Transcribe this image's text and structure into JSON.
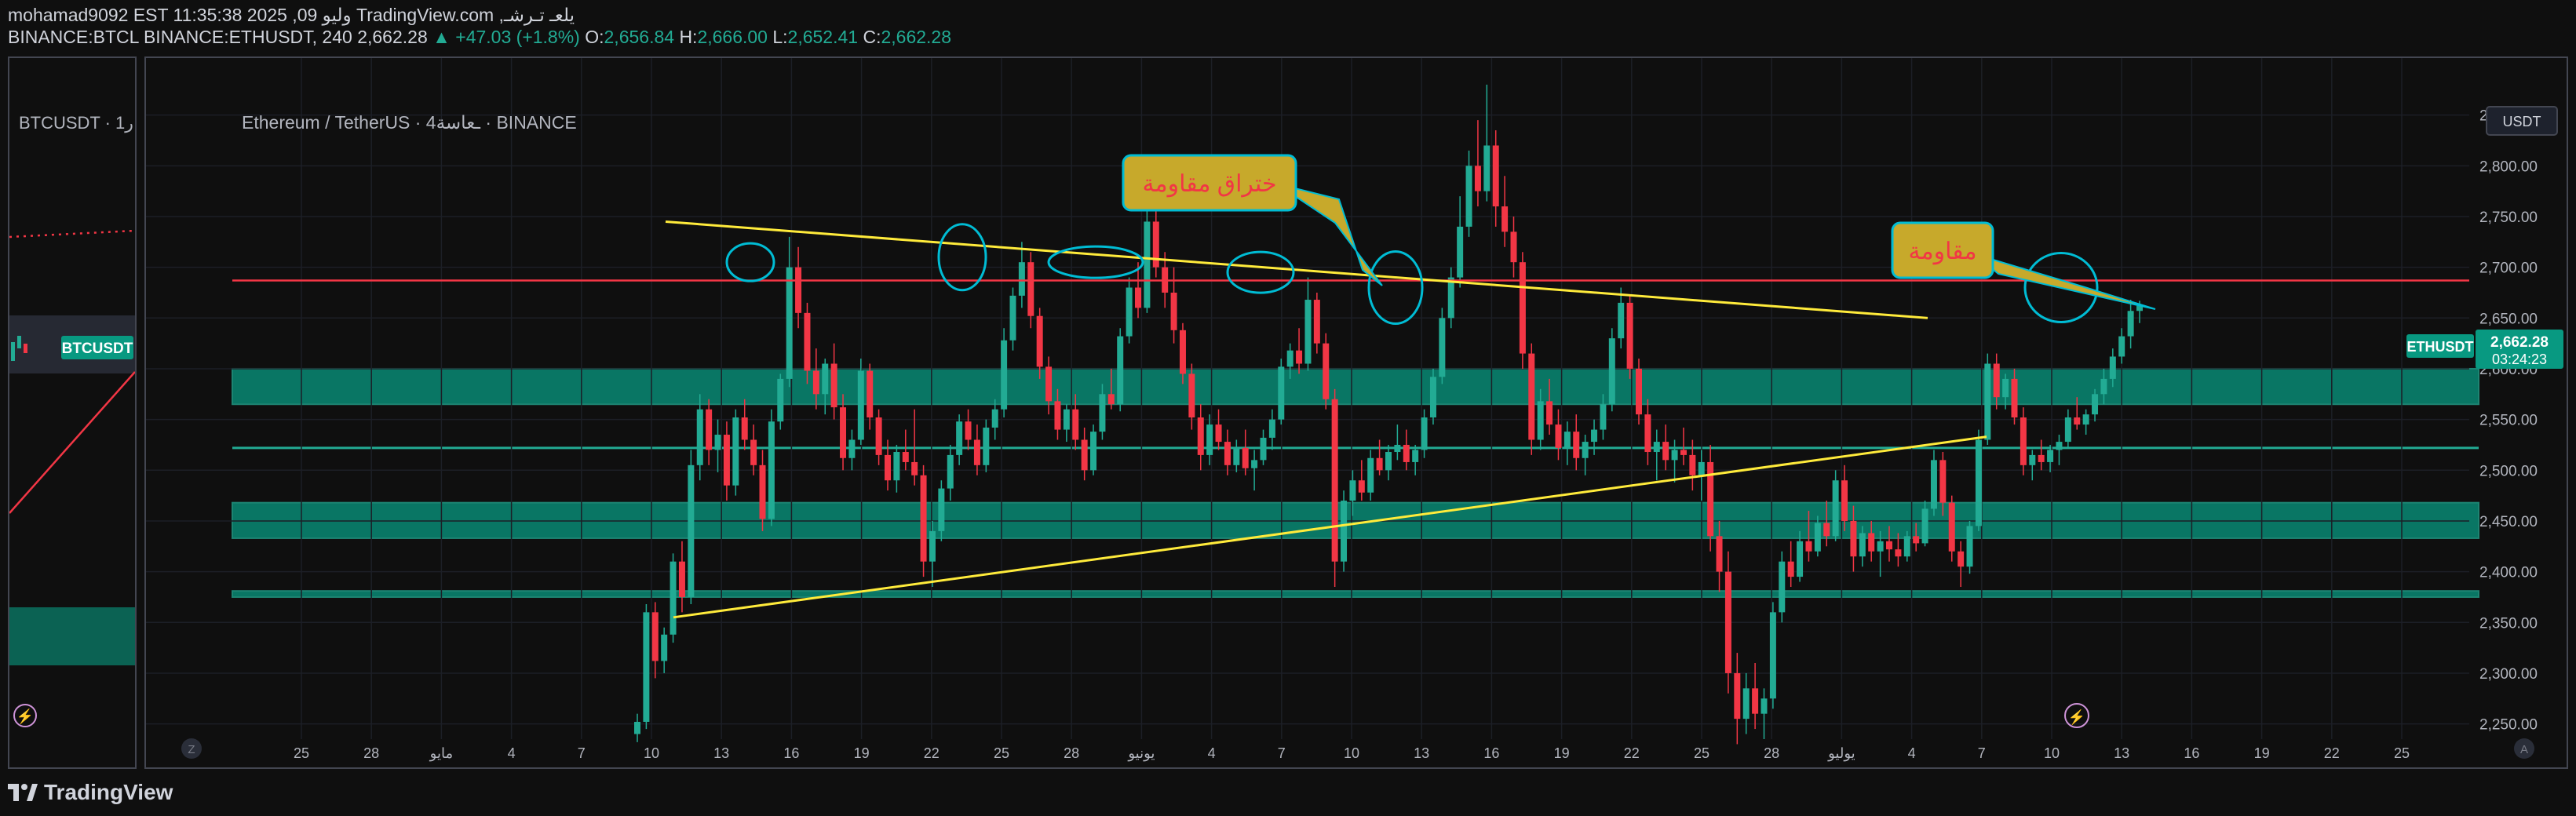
{
  "header": {
    "line1": "mohamad9092 EST 11:35:38 2025 ,09 وليو TradingView.com ,يلعـ تـرشـ",
    "symbols": "BINANCE:BTCL BINANCE:ETHUSDT, 240",
    "price": "2,662.28",
    "change": "▲ +47.03 (+1.8%)",
    "o_label": "O:",
    "o": "2,656.84",
    "h_label": "H:",
    "h": "2,666.00",
    "l_label": "L:",
    "l": "2,652.41",
    "c_label": "C:",
    "c": "2,662.28"
  },
  "left_pane": {
    "title": "BTCUSDT · 1ر",
    "price_badge": "BTCUSDT"
  },
  "main_pane": {
    "title": "Ethereum / TetherUS · 4ـعاسة · BINANCE",
    "currency_button": "USDT",
    "price_tag": "2,662.28",
    "countdown": "03:24:23",
    "symbol_tag": "ETHUSDT",
    "z_button": "Z",
    "a_button": "A"
  },
  "footer": {
    "logo_text": "TradingView"
  },
  "annotations": {
    "breakout_callout": "ختراق مقاومة",
    "resistance_callout": "مقاومة"
  },
  "colors": {
    "up": "#22ab94",
    "down": "#f23645",
    "zone": "#089981",
    "trendline": "#ffeb3b",
    "resistance_line": "#f23645",
    "circles": "#00bcd4",
    "callout_fill": "#c7a92b",
    "callout_text": "#f23645"
  },
  "chart_data": {
    "type": "candlestick",
    "title": "Ethereum / TetherUS · 4ـعاسة · BINANCE",
    "y_axis": {
      "ticks": [
        "2,250.00",
        "2,300.00",
        "2,350.00",
        "2,400.00",
        "2,450.00",
        "2,500.00",
        "2,550.00",
        "2,600.00",
        "2,650.00",
        "2,700.00",
        "2,750.00",
        "2,800.00",
        "2,850.00"
      ],
      "range": [
        2235,
        2900
      ]
    },
    "x_axis": {
      "ticks": [
        "25",
        "28",
        "مايو",
        "4",
        "7",
        "10",
        "13",
        "16",
        "19",
        "22",
        "25",
        "28",
        "يونيو",
        "4",
        "7",
        "10",
        "13",
        "16",
        "19",
        "22",
        "25",
        "28",
        "يوليو",
        "4",
        "7",
        "10",
        "13",
        "16",
        "19",
        "22",
        "25"
      ]
    },
    "last_price": 2662.28,
    "resistance_level": 2687,
    "support_zones": [
      [
        2565,
        2600
      ],
      [
        2433,
        2468
      ],
      [
        2375,
        2381
      ]
    ],
    "support_line": 2522,
    "trendlines": [
      {
        "from": [
          "May 11",
          2745
        ],
        "to": [
          "Jul 3",
          2650
        ]
      },
      {
        "from": [
          "May 11",
          2355
        ],
        "to": [
          "Jul 6",
          2533
        ]
      }
    ],
    "circled_highs": [
      "May 14",
      "May 23",
      "May 28",
      "Jun 5",
      "Jun 10",
      "Jul 9"
    ],
    "series": [
      {
        "name": "ETHUSDT",
        "ohlc": [
          [
            2240,
            2260,
            2232,
            2252
          ],
          [
            2252,
            2368,
            2245,
            2360
          ],
          [
            2360,
            2370,
            2295,
            2312
          ],
          [
            2312,
            2345,
            2300,
            2338
          ],
          [
            2338,
            2418,
            2330,
            2410
          ],
          [
            2410,
            2430,
            2360,
            2375
          ],
          [
            2375,
            2520,
            2368,
            2505
          ],
          [
            2505,
            2575,
            2490,
            2560
          ],
          [
            2560,
            2570,
            2505,
            2520
          ],
          [
            2520,
            2550,
            2498,
            2535
          ],
          [
            2535,
            2548,
            2470,
            2485
          ],
          [
            2485,
            2560,
            2475,
            2552
          ],
          [
            2552,
            2570,
            2520,
            2530
          ],
          [
            2530,
            2545,
            2495,
            2505
          ],
          [
            2505,
            2520,
            2440,
            2452
          ],
          [
            2452,
            2560,
            2445,
            2548
          ],
          [
            2548,
            2595,
            2540,
            2590
          ],
          [
            2590,
            2730,
            2582,
            2700
          ],
          [
            2700,
            2720,
            2640,
            2655
          ],
          [
            2655,
            2665,
            2585,
            2598
          ],
          [
            2598,
            2620,
            2560,
            2575
          ],
          [
            2575,
            2610,
            2555,
            2605
          ],
          [
            2605,
            2625,
            2550,
            2562
          ],
          [
            2562,
            2575,
            2500,
            2512
          ],
          [
            2512,
            2540,
            2500,
            2530
          ],
          [
            2530,
            2610,
            2525,
            2598
          ],
          [
            2598,
            2605,
            2540,
            2552
          ],
          [
            2552,
            2560,
            2505,
            2515
          ],
          [
            2515,
            2530,
            2480,
            2490
          ],
          [
            2490,
            2525,
            2478,
            2518
          ],
          [
            2518,
            2540,
            2500,
            2508
          ],
          [
            2508,
            2560,
            2485,
            2495
          ],
          [
            2495,
            2505,
            2395,
            2410
          ],
          [
            2410,
            2450,
            2385,
            2440
          ],
          [
            2440,
            2490,
            2430,
            2482
          ],
          [
            2482,
            2525,
            2470,
            2515
          ],
          [
            2515,
            2555,
            2505,
            2548
          ],
          [
            2548,
            2560,
            2520,
            2530
          ],
          [
            2530,
            2545,
            2495,
            2505
          ],
          [
            2505,
            2550,
            2498,
            2542
          ],
          [
            2542,
            2570,
            2530,
            2560
          ],
          [
            2560,
            2640,
            2552,
            2628
          ],
          [
            2628,
            2680,
            2618,
            2672
          ],
          [
            2672,
            2725,
            2660,
            2705
          ],
          [
            2705,
            2715,
            2640,
            2652
          ],
          [
            2652,
            2660,
            2590,
            2602
          ],
          [
            2602,
            2612,
            2555,
            2568
          ],
          [
            2568,
            2580,
            2530,
            2540
          ],
          [
            2540,
            2565,
            2528,
            2560
          ],
          [
            2560,
            2575,
            2520,
            2530
          ],
          [
            2530,
            2542,
            2490,
            2500
          ],
          [
            2500,
            2545,
            2495,
            2538
          ],
          [
            2538,
            2585,
            2530,
            2575
          ],
          [
            2575,
            2600,
            2560,
            2565
          ],
          [
            2565,
            2640,
            2558,
            2632
          ],
          [
            2632,
            2690,
            2625,
            2680
          ],
          [
            2680,
            2705,
            2650,
            2660
          ],
          [
            2660,
            2775,
            2655,
            2745
          ],
          [
            2745,
            2755,
            2690,
            2700
          ],
          [
            2700,
            2715,
            2660,
            2675
          ],
          [
            2675,
            2700,
            2625,
            2638
          ],
          [
            2638,
            2645,
            2585,
            2595
          ],
          [
            2595,
            2605,
            2540,
            2552
          ],
          [
            2552,
            2565,
            2500,
            2515
          ],
          [
            2515,
            2555,
            2505,
            2545
          ],
          [
            2545,
            2560,
            2520,
            2528
          ],
          [
            2528,
            2540,
            2495,
            2505
          ],
          [
            2505,
            2530,
            2498,
            2522
          ],
          [
            2522,
            2540,
            2495,
            2502
          ],
          [
            2502,
            2520,
            2480,
            2510
          ],
          [
            2510,
            2540,
            2505,
            2532
          ],
          [
            2532,
            2560,
            2520,
            2550
          ],
          [
            2550,
            2610,
            2545,
            2602
          ],
          [
            2602,
            2625,
            2590,
            2618
          ],
          [
            2618,
            2640,
            2595,
            2605
          ],
          [
            2605,
            2690,
            2598,
            2668
          ],
          [
            2668,
            2675,
            2615,
            2625
          ],
          [
            2625,
            2635,
            2560,
            2570
          ],
          [
            2570,
            2580,
            2385,
            2410
          ],
          [
            2410,
            2480,
            2400,
            2470
          ],
          [
            2470,
            2500,
            2455,
            2490
          ],
          [
            2490,
            2510,
            2470,
            2478
          ],
          [
            2478,
            2520,
            2470,
            2512
          ],
          [
            2512,
            2530,
            2495,
            2500
          ],
          [
            2500,
            2525,
            2490,
            2518
          ],
          [
            2518,
            2545,
            2510,
            2525
          ],
          [
            2525,
            2540,
            2500,
            2508
          ],
          [
            2508,
            2525,
            2495,
            2520
          ],
          [
            2520,
            2560,
            2512,
            2552
          ],
          [
            2552,
            2600,
            2545,
            2592
          ],
          [
            2592,
            2660,
            2585,
            2650
          ],
          [
            2650,
            2700,
            2640,
            2690
          ],
          [
            2690,
            2770,
            2680,
            2740
          ],
          [
            2740,
            2815,
            2730,
            2800
          ],
          [
            2800,
            2845,
            2760,
            2775
          ],
          [
            2775,
            2880,
            2765,
            2820
          ],
          [
            2820,
            2835,
            2740,
            2760
          ],
          [
            2760,
            2790,
            2720,
            2735
          ],
          [
            2735,
            2750,
            2690,
            2705
          ],
          [
            2705,
            2715,
            2600,
            2615
          ],
          [
            2615,
            2625,
            2515,
            2530
          ],
          [
            2530,
            2580,
            2520,
            2568
          ],
          [
            2568,
            2590,
            2535,
            2545
          ],
          [
            2545,
            2560,
            2510,
            2522
          ],
          [
            2522,
            2548,
            2505,
            2538
          ],
          [
            2538,
            2555,
            2500,
            2512
          ],
          [
            2512,
            2535,
            2495,
            2528
          ],
          [
            2528,
            2550,
            2515,
            2540
          ],
          [
            2540,
            2575,
            2530,
            2565
          ],
          [
            2565,
            2640,
            2558,
            2630
          ],
          [
            2630,
            2680,
            2620,
            2665
          ],
          [
            2665,
            2672,
            2590,
            2600
          ],
          [
            2600,
            2610,
            2545,
            2555
          ],
          [
            2555,
            2570,
            2505,
            2518
          ],
          [
            2518,
            2540,
            2490,
            2528
          ],
          [
            2528,
            2545,
            2500,
            2510
          ],
          [
            2510,
            2530,
            2488,
            2520
          ],
          [
            2520,
            2542,
            2505,
            2515
          ],
          [
            2515,
            2530,
            2480,
            2495
          ],
          [
            2495,
            2520,
            2470,
            2508
          ],
          [
            2508,
            2525,
            2420,
            2435
          ],
          [
            2435,
            2450,
            2380,
            2400
          ],
          [
            2400,
            2420,
            2280,
            2300
          ],
          [
            2300,
            2320,
            2230,
            2255
          ],
          [
            2255,
            2300,
            2240,
            2285
          ],
          [
            2285,
            2310,
            2245,
            2260
          ],
          [
            2260,
            2285,
            2235,
            2275
          ],
          [
            2275,
            2370,
            2265,
            2360
          ],
          [
            2360,
            2420,
            2350,
            2410
          ],
          [
            2410,
            2430,
            2385,
            2395
          ],
          [
            2395,
            2440,
            2390,
            2430
          ],
          [
            2430,
            2460,
            2410,
            2420
          ],
          [
            2420,
            2455,
            2415,
            2448
          ],
          [
            2448,
            2470,
            2425,
            2435
          ],
          [
            2435,
            2500,
            2430,
            2490
          ],
          [
            2490,
            2505,
            2440,
            2450
          ],
          [
            2450,
            2465,
            2400,
            2415
          ],
          [
            2415,
            2445,
            2405,
            2438
          ],
          [
            2438,
            2450,
            2410,
            2420
          ],
          [
            2420,
            2440,
            2395,
            2430
          ],
          [
            2430,
            2445,
            2410,
            2422
          ],
          [
            2422,
            2438,
            2405,
            2415
          ],
          [
            2415,
            2440,
            2410,
            2435
          ],
          [
            2435,
            2448,
            2420,
            2428
          ],
          [
            2428,
            2470,
            2425,
            2462
          ],
          [
            2462,
            2520,
            2455,
            2510
          ],
          [
            2510,
            2518,
            2455,
            2468
          ],
          [
            2468,
            2475,
            2410,
            2420
          ],
          [
            2420,
            2430,
            2385,
            2405
          ],
          [
            2405,
            2450,
            2398,
            2445
          ],
          [
            2445,
            2540,
            2440,
            2530
          ],
          [
            2530,
            2615,
            2525,
            2605
          ],
          [
            2605,
            2615,
            2560,
            2572
          ],
          [
            2572,
            2595,
            2560,
            2590
          ],
          [
            2590,
            2600,
            2545,
            2552
          ],
          [
            2552,
            2562,
            2495,
            2505
          ],
          [
            2505,
            2520,
            2490,
            2515
          ],
          [
            2515,
            2530,
            2500,
            2508
          ],
          [
            2508,
            2525,
            2498,
            2520
          ],
          [
            2520,
            2535,
            2505,
            2528
          ],
          [
            2528,
            2560,
            2522,
            2552
          ],
          [
            2552,
            2572,
            2540,
            2545
          ],
          [
            2545,
            2560,
            2535,
            2555
          ],
          [
            2555,
            2580,
            2548,
            2575
          ],
          [
            2575,
            2600,
            2565,
            2590
          ],
          [
            2590,
            2620,
            2582,
            2612
          ],
          [
            2612,
            2640,
            2605,
            2632
          ],
          [
            2632,
            2668,
            2620,
            2657
          ],
          [
            2657,
            2667,
            2645,
            2662
          ]
        ]
      }
    ]
  }
}
